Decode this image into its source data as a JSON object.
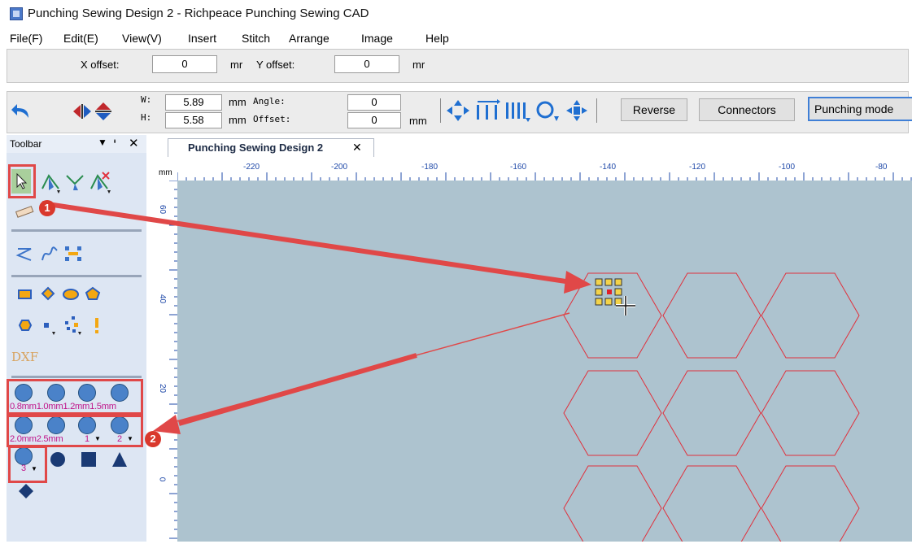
{
  "window": {
    "title": "Punching Sewing Design 2 - Richpeace Punching Sewing CAD"
  },
  "menu": [
    "File(F)",
    "Edit(E)",
    "View(V)",
    "Insert",
    "Stitch",
    "Arrange",
    "Image",
    "Help"
  ],
  "offset_bar": {
    "x_label": "X offset:",
    "x_value": "0",
    "x_unit": "mr",
    "y_label": "Y offset:",
    "y_value": "0",
    "y_unit": "mr"
  },
  "geometry_bar": {
    "w_label": "W:",
    "w_value": "5.89",
    "w_unit": "mm",
    "h_label": "H:",
    "h_value": "5.58",
    "h_unit": "mm",
    "angle_label": "Angle:",
    "angle_value": "0",
    "offset_label": "Offset:",
    "offset_value": "0",
    "offset_unit": "mm",
    "reverse_label": "Reverse",
    "connectors_label": "Connectors",
    "punching_label": "Punching mode"
  },
  "toolbar": {
    "title": "Toolbar",
    "dxf_label": "DXF",
    "circle_row1_labels": "0.8mm1.0mm1.2mm1.5mm",
    "circle_row2_labels": "2.0mm2.5mm",
    "custom1": "1",
    "custom2": "2",
    "custom3": "3"
  },
  "document": {
    "tab_label": "Punching Sewing Design 2",
    "unit": "mm"
  },
  "ruler": {
    "h_ticks": [
      "-220",
      "-200",
      "-180",
      "-160",
      "-140",
      "-120",
      "-100",
      "-80"
    ],
    "v_ticks": [
      "60",
      "40",
      "20",
      "0"
    ]
  },
  "annotations": {
    "badge1": "1",
    "badge2": "2"
  },
  "colors": {
    "hexagon_stroke": "#e0303c",
    "annotation": "#e04848",
    "canvas": "#adc3cf",
    "tool_circle": "#4a82c9"
  }
}
